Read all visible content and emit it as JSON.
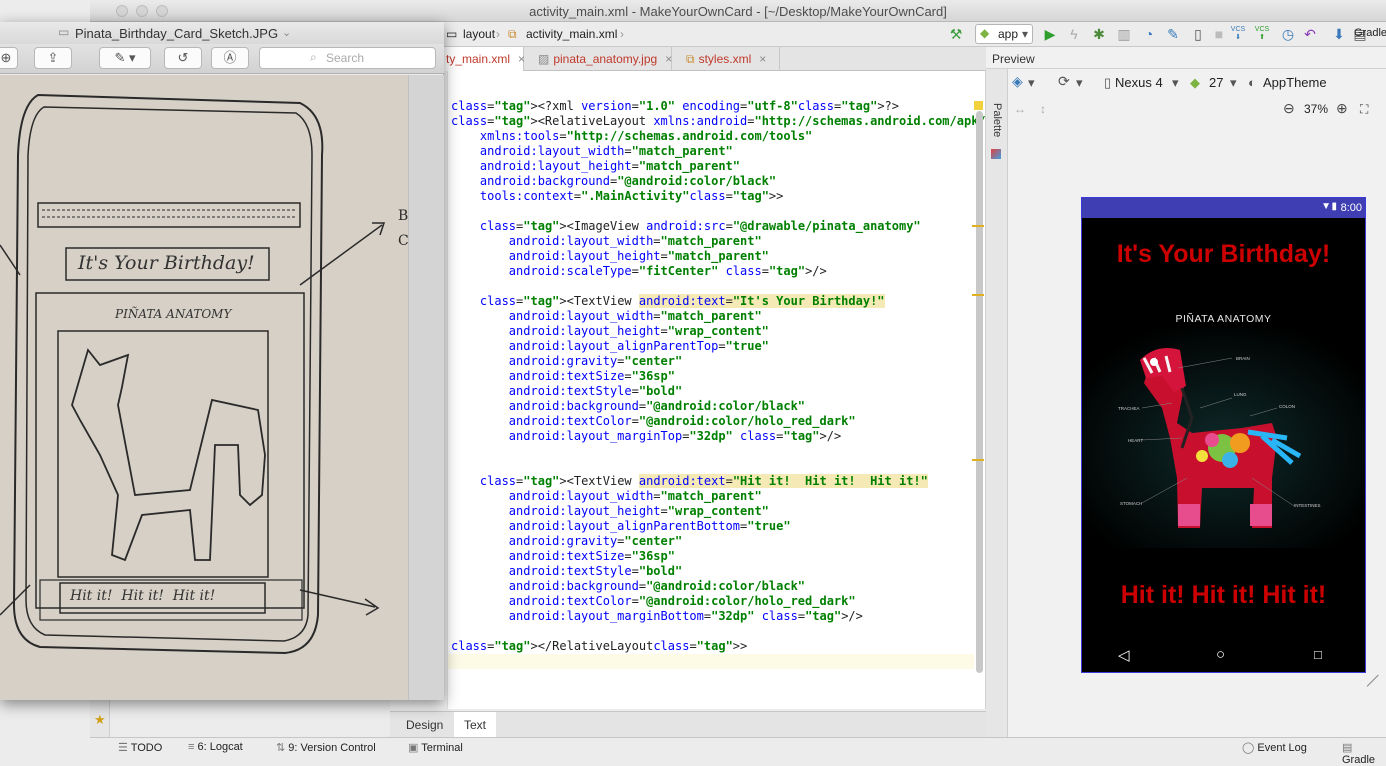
{
  "studio": {
    "window_title": "activity_main.xml - MakeYourOwnCard - [~/Desktop/MakeYourOwnCard]",
    "breadcrumbs": [
      "layout",
      "activity_main.xml"
    ],
    "run_config": "app",
    "toolbar_labels": {
      "vcs1": "VCS",
      "vcs2": "VCS",
      "gradle": "Gradle"
    }
  },
  "editor": {
    "tabs": [
      {
        "label": "ty_main.xml",
        "active": true
      },
      {
        "label": "pinata_anatomy.jpg",
        "active": false
      },
      {
        "label": "styles.xml",
        "active": false
      }
    ],
    "bottom_tabs": [
      "Design",
      "Text"
    ],
    "active_bottom_tab": "Text",
    "code": [
      "<?xml version=\"1.0\" encoding=\"utf-8\"?>",
      "<RelativeLayout xmlns:android=\"http://schemas.android.com/apk/res/android\"",
      "    xmlns:tools=\"http://schemas.android.com/tools\"",
      "    android:layout_width=\"match_parent\"",
      "    android:layout_height=\"match_parent\"",
      "    android:background=\"@android:color/black\"",
      "    tools:context=\".MainActivity\">",
      "",
      "    <ImageView android:src=\"@drawable/pinata_anatomy\"",
      "        android:layout_width=\"match_parent\"",
      "        android:layout_height=\"match_parent\"",
      "        android:scaleType=\"fitCenter\" />",
      "",
      "    <TextView android:text=\"It's Your Birthday!\"",
      "        android:layout_width=\"match_parent\"",
      "        android:layout_height=\"wrap_content\"",
      "        android:layout_alignParentTop=\"true\"",
      "        android:gravity=\"center\"",
      "        android:textSize=\"36sp\"",
      "        android:textStyle=\"bold\"",
      "        android:background=\"@android:color/black\"",
      "        android:textColor=\"@android:color/holo_red_dark\"",
      "        android:layout_marginTop=\"32dp\" />",
      "",
      "",
      "    <TextView android:text=\"Hit it!  Hit it!  Hit it!\"",
      "        android:layout_width=\"match_parent\"",
      "        android:layout_height=\"wrap_content\"",
      "        android:layout_alignParentBottom=\"true\"",
      "        android:gravity=\"center\"",
      "        android:textSize=\"36sp\"",
      "        android:textStyle=\"bold\"",
      "        android:background=\"@android:color/black\"",
      "        android:textColor=\"@android:color/holo_red_dark\"",
      "        android:layout_marginBottom=\"32dp\" />",
      "",
      "</RelativeLayout>"
    ]
  },
  "status_bar": {
    "items": [
      "TODO",
      "6: Logcat",
      "9: Version Control",
      "Terminal"
    ],
    "right_items": [
      "Event Log",
      "Gradle"
    ]
  },
  "preview": {
    "header": "Preview",
    "palette_label": "Palette",
    "device": "Nexus 4",
    "api_level": "27",
    "theme": "AppTheme",
    "zoom": "37%",
    "phone": {
      "time": "8:00",
      "top_text": "It's Your Birthday!",
      "image_title": "PIÑATA ANATOMY",
      "image_labels": [
        "BRAIN",
        "LUNG",
        "COLON",
        "TRACHEA",
        "HEART",
        "STOMACH",
        "INTESTINES"
      ],
      "bottom_text": "Hit it!  Hit it!  Hit it!",
      "text_color": "#cc0000",
      "background": "#000000"
    }
  },
  "photo_viewer": {
    "title": "Pinata_Birthday_Card_Sketch.JPG",
    "search_placeholder": "Search",
    "sketch_texts": [
      "It's Your Birthday!",
      "PIÑATA ANATOMY",
      "Hit it!  Hit it!  Hit it!"
    ]
  }
}
